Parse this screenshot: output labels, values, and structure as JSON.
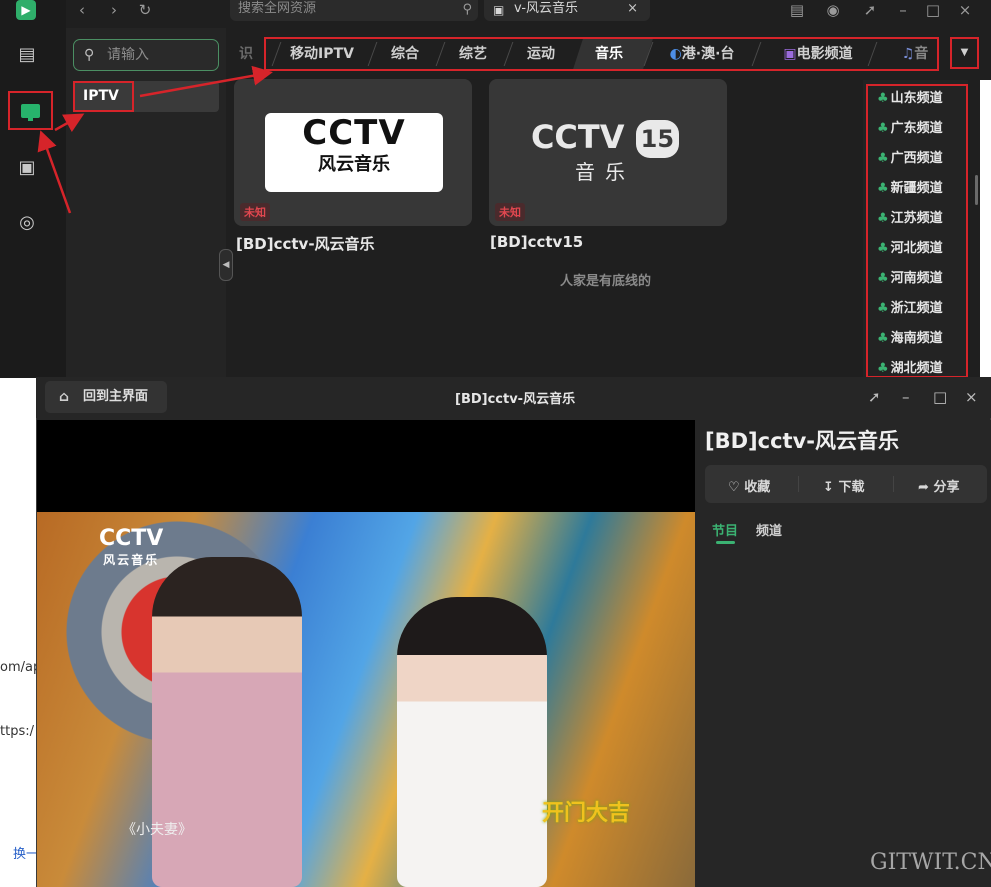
{
  "topbar": {
    "search_placeholder": "搜索全网资源",
    "tab_label": "v-风云音乐"
  },
  "sidebar": {
    "filter_placeholder": "请输入",
    "source_item": "IPTV"
  },
  "categories": {
    "partial_left": "识",
    "items": [
      "移动IPTV",
      "综合",
      "综艺",
      "运动",
      "音乐",
      "港·澳·台",
      "电影频道",
      "音乐"
    ],
    "active": "音乐"
  },
  "cards": [
    {
      "badge": "未知",
      "title": "[BD]cctv-风云音乐",
      "logo_top": "CCTV",
      "logo_bottom": "风云音乐"
    },
    {
      "badge": "未知",
      "title": "[BD]cctv15",
      "logo_top": "CCTV",
      "logo_num": "15",
      "logo_bottom": "音乐"
    }
  ],
  "list_footer": "人家是有底线的",
  "channel_dropdown": [
    "山东频道",
    "广东频道",
    "广西频道",
    "新疆频道",
    "江苏频道",
    "河北频道",
    "河南频道",
    "浙江频道",
    "海南频道",
    "湖北频道"
  ],
  "background_fragments": [
    "om/ap",
    "ttps:/",
    "换一"
  ],
  "player": {
    "home_label": "回到主界面",
    "window_title": "[BD]cctv-风云音乐",
    "program_name": "[BD]cctv-风云音乐",
    "actions": {
      "favorite": "收藏",
      "download": "下载",
      "share": "分享"
    },
    "tabs": {
      "program": "节目",
      "channel": "频道"
    },
    "video": {
      "watermark_top": "CCTV",
      "watermark_bottom": "风云音乐",
      "subtitle": "《小夫妻》",
      "show_logo": "开门大吉"
    }
  },
  "site_watermark": "GITWIT.CN",
  "colors": {
    "accent_green": "#3bb272",
    "annotation_red": "#d6242a",
    "badge_red": "#e0474f"
  }
}
